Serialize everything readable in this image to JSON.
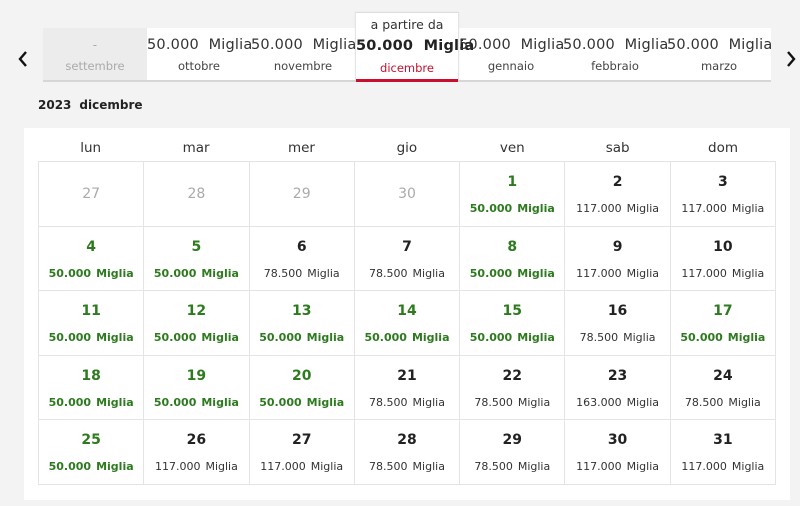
{
  "months": [
    {
      "price": "-",
      "unit": "",
      "name": "settembre",
      "state": "disabled"
    },
    {
      "price": "50.000",
      "unit": "Miglia",
      "name": "ottobre",
      "state": "normal"
    },
    {
      "price": "50.000",
      "unit": "Miglia",
      "name": "novembre",
      "state": "normal"
    },
    {
      "from": "a partire da",
      "price": "50.000",
      "unit": "Miglia",
      "name": "dicembre",
      "state": "selected"
    },
    {
      "price": "50.000",
      "unit": "Miglia",
      "name": "gennaio",
      "state": "normal"
    },
    {
      "price": "50.000",
      "unit": "Miglia",
      "name": "febbraio",
      "state": "normal"
    },
    {
      "price": "50.000",
      "unit": "Miglia",
      "name": "marzo",
      "state": "normal"
    }
  ],
  "heading": {
    "year": "2023",
    "month": "dicembre"
  },
  "weekdays": [
    "lun",
    "mar",
    "mer",
    "gio",
    "ven",
    "sab",
    "dom"
  ],
  "unit": "Miglia",
  "colors": {
    "green": "#2d7a1f",
    "accent": "#c8102e"
  },
  "days": [
    {
      "n": "27",
      "muted": true
    },
    {
      "n": "28",
      "muted": true
    },
    {
      "n": "29",
      "muted": true
    },
    {
      "n": "30",
      "muted": true
    },
    {
      "n": "1",
      "price": "50.000",
      "green": true
    },
    {
      "n": "2",
      "price": "117.000"
    },
    {
      "n": "3",
      "price": "117.000"
    },
    {
      "n": "4",
      "price": "50.000",
      "green": true
    },
    {
      "n": "5",
      "price": "50.000",
      "green": true
    },
    {
      "n": "6",
      "price": "78.500"
    },
    {
      "n": "7",
      "price": "78.500"
    },
    {
      "n": "8",
      "price": "50.000",
      "green": true
    },
    {
      "n": "9",
      "price": "117.000"
    },
    {
      "n": "10",
      "price": "117.000"
    },
    {
      "n": "11",
      "price": "50.000",
      "green": true
    },
    {
      "n": "12",
      "price": "50.000",
      "green": true
    },
    {
      "n": "13",
      "price": "50.000",
      "green": true
    },
    {
      "n": "14",
      "price": "50.000",
      "green": true
    },
    {
      "n": "15",
      "price": "50.000",
      "green": true
    },
    {
      "n": "16",
      "price": "78.500"
    },
    {
      "n": "17",
      "price": "50.000",
      "green": true
    },
    {
      "n": "18",
      "price": "50.000",
      "green": true
    },
    {
      "n": "19",
      "price": "50.000",
      "green": true
    },
    {
      "n": "20",
      "price": "50.000",
      "green": true
    },
    {
      "n": "21",
      "price": "78.500"
    },
    {
      "n": "22",
      "price": "78.500"
    },
    {
      "n": "23",
      "price": "163.000"
    },
    {
      "n": "24",
      "price": "78.500"
    },
    {
      "n": "25",
      "price": "50.000",
      "green": true
    },
    {
      "n": "26",
      "price": "117.000"
    },
    {
      "n": "27",
      "price": "117.000"
    },
    {
      "n": "28",
      "price": "78.500"
    },
    {
      "n": "29",
      "price": "78.500"
    },
    {
      "n": "30",
      "price": "117.000"
    },
    {
      "n": "31",
      "price": "117.000"
    }
  ]
}
